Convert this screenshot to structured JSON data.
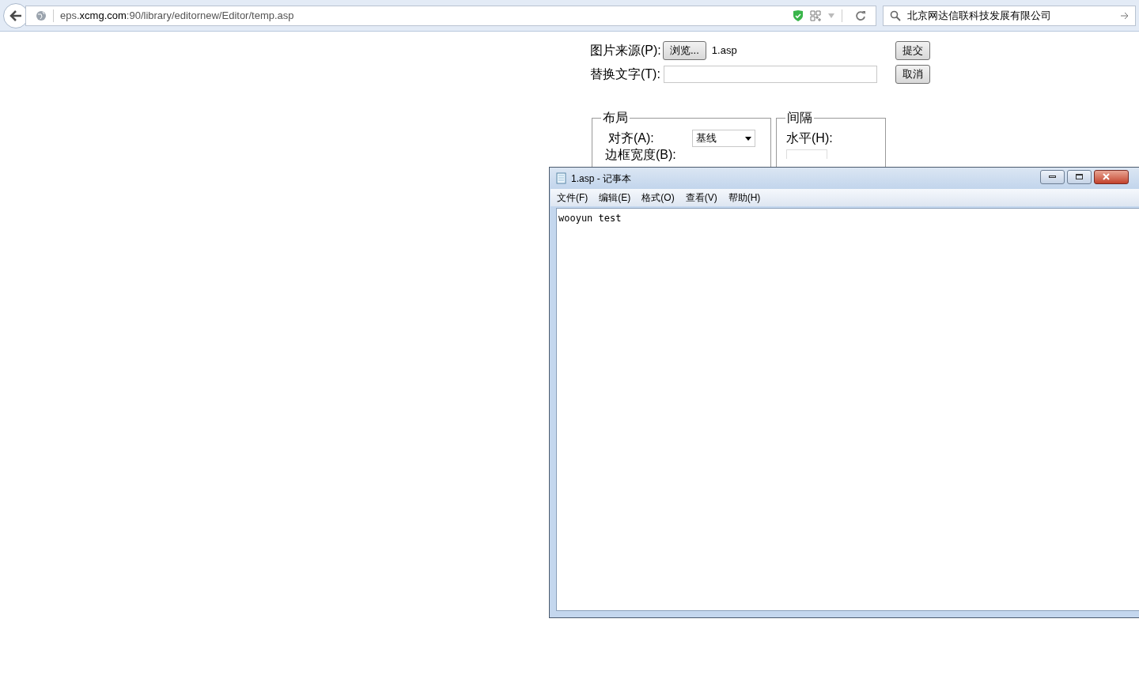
{
  "browser": {
    "address": {
      "host_prefix": "eps.",
      "host": "xcmg.com",
      "rest": ":90/library/editornew/Editor/temp.asp"
    },
    "search": {
      "value": "北京网达信联科技发展有限公司"
    }
  },
  "form": {
    "source_label": "图片来源(P):",
    "browse_button": "浏览...",
    "file_name": "1.asp",
    "alt_label": "替换文字(T):",
    "submit_button": "提交",
    "cancel_button": "取消",
    "layout": {
      "legend": "布局",
      "align_label": "对齐(A):",
      "align_value": "基线",
      "border_label": "边框宽度(B):"
    },
    "spacing": {
      "legend": "间隔",
      "horizontal_label": "水平(H):"
    }
  },
  "notepad": {
    "title": "1.asp - 记事本",
    "menu": [
      "文件(F)",
      "编辑(E)",
      "格式(O)",
      "查看(V)",
      "帮助(H)"
    ],
    "content": "wooyun test"
  }
}
